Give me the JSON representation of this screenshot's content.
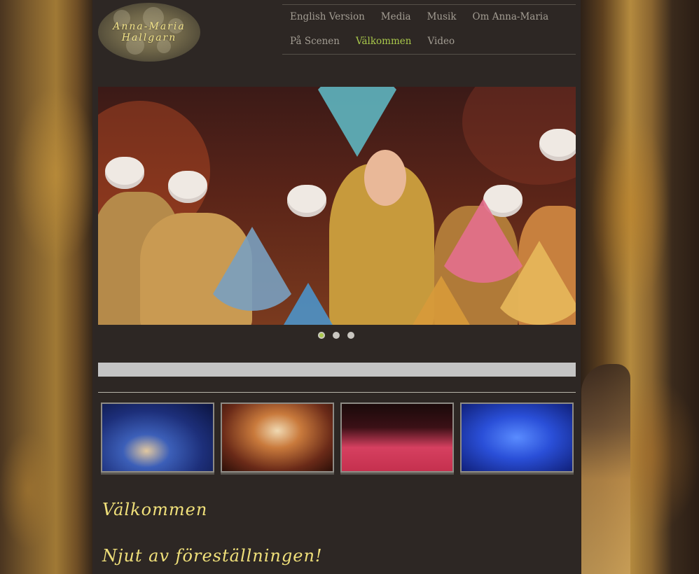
{
  "logo": {
    "line1": "Anna-Maria",
    "line2": "Hallgarn"
  },
  "nav": {
    "row1": [
      {
        "label": "English Version",
        "active": false
      },
      {
        "label": "Media",
        "active": false
      },
      {
        "label": "Musik",
        "active": false
      },
      {
        "label": "Om Anna-Maria",
        "active": false
      }
    ],
    "row2": [
      {
        "label": "På Scenen",
        "active": false
      },
      {
        "label": "Välkommen",
        "active": true
      },
      {
        "label": "Video",
        "active": false
      }
    ]
  },
  "slider": {
    "slide_count": 3,
    "active_index": 0
  },
  "thumbnails": [
    {
      "subject": "blue-stage-ensemble-photo"
    },
    {
      "subject": "orange-stage-dancers-photo"
    },
    {
      "subject": "red-stage-legs-up-photo"
    },
    {
      "subject": "blue-stage-seated-cast-photo"
    }
  ],
  "content": {
    "title": "Välkommen",
    "subtitle": "Njut av föreställningen!"
  },
  "colors": {
    "accent": "#a9c84b",
    "heading": "#f0e07a",
    "nav_text": "#a39d93"
  }
}
